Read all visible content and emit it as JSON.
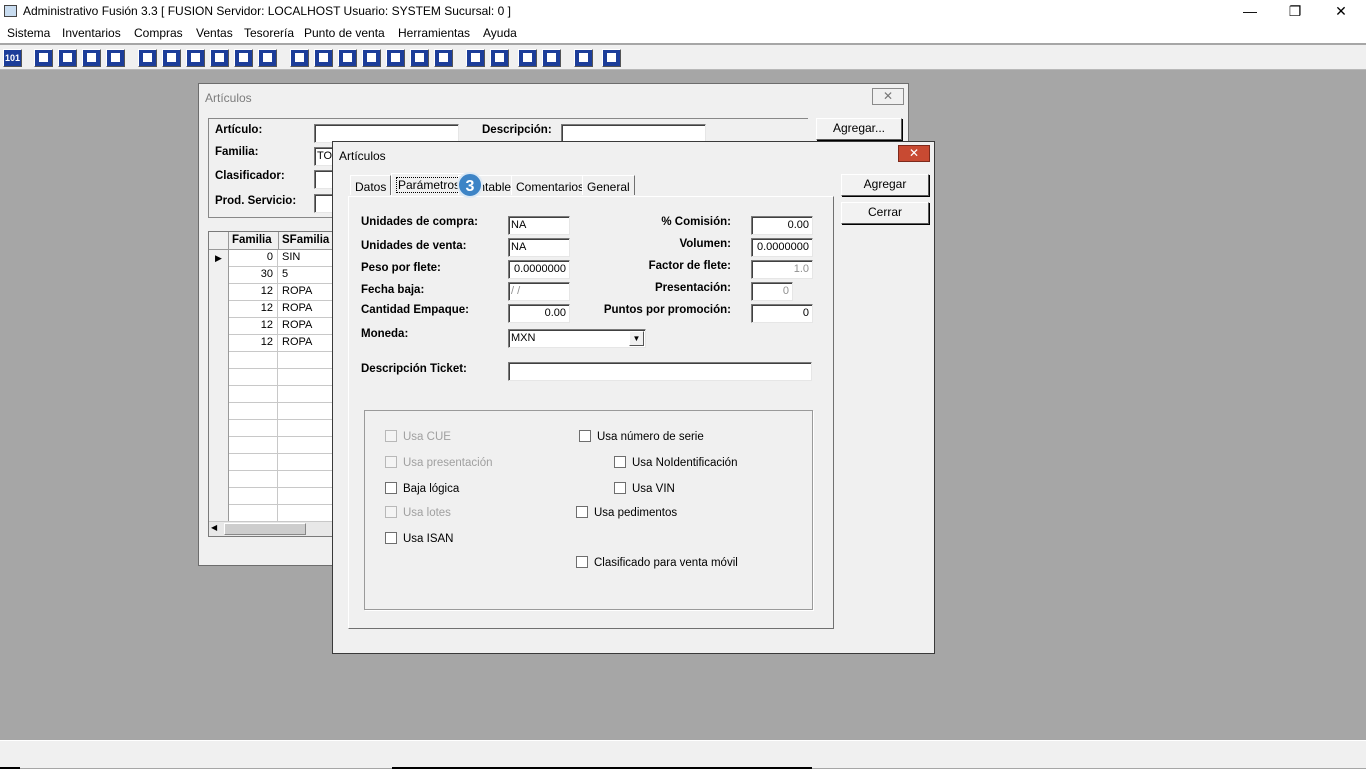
{
  "app": {
    "title": "Administrativo Fusión 3.3 [ FUSION  Servidor: LOCALHOST   Usuario: SYSTEM    Sucursal: 0 ]",
    "window_controls": {
      "minimize": "—",
      "restore": "❐",
      "close": "✕"
    }
  },
  "menu": [
    "Sistema",
    "Inventarios",
    "Compras",
    "Ventas",
    "Tesorería",
    "Punto de venta",
    "Herramientas",
    "Ayuda"
  ],
  "toolbar_first_label": "101",
  "bg_window": {
    "title": "Artículos",
    "close": "✕",
    "labels": {
      "articulo": "Artículo:",
      "descripcion": "Descripción:",
      "familia": "Familia:",
      "clasificador": "Clasificador:",
      "prod_servicio": "Prod. Servicio:"
    },
    "familia_value": "TO",
    "add_button": "Agregar...",
    "grid": {
      "headers": [
        "Familia",
        "SFamilia"
      ],
      "current_marker": "▶",
      "rows": [
        {
          "familia": "0",
          "sfamilia": "SIN"
        },
        {
          "familia": "30",
          "sfamilia": "5"
        },
        {
          "familia": "12",
          "sfamilia": "ROPA"
        },
        {
          "familia": "12",
          "sfamilia": "ROPA"
        },
        {
          "familia": "12",
          "sfamilia": "ROPA"
        },
        {
          "familia": "12",
          "sfamilia": "ROPA"
        }
      ],
      "scroll_arrow": "◀"
    }
  },
  "dialog": {
    "title": "Artículos",
    "close": "✕",
    "tabs": [
      "Datos",
      "Parámetros",
      "Contable",
      "Comentarios",
      "General"
    ],
    "active_tab": "Parámetros",
    "step_badge": "3",
    "buttons": {
      "agregar": "Agregar",
      "cerrar": "Cerrar"
    },
    "left_fields": [
      {
        "label": "Unidades de compra:",
        "value": "NA"
      },
      {
        "label": "Unidades de venta:",
        "value": "NA"
      },
      {
        "label": "Peso por flete:",
        "value": "0.0000000"
      },
      {
        "label": "Fecha baja:",
        "value": " /  /"
      },
      {
        "label": "Cantidad Empaque:",
        "value": "0.00"
      }
    ],
    "right_fields": [
      {
        "label": "% Comisión:",
        "value": "0.00"
      },
      {
        "label": "Volumen:",
        "value": "0.0000000"
      },
      {
        "label": "Factor de flete:",
        "value": "1.0"
      },
      {
        "label": "Presentación:",
        "value": "0"
      },
      {
        "label": "Puntos por promoción:",
        "value": "0"
      }
    ],
    "moneda": {
      "label": "Moneda:",
      "value": "MXN",
      "arrow": "▼"
    },
    "ticket": {
      "label": "Descripción Ticket:",
      "value": ""
    },
    "checkboxes": {
      "usa_cue": "Usa CUE",
      "usa_presentacion": "Usa presentación",
      "baja_logica": "Baja lógica",
      "usa_lotes": "Usa lotes",
      "usa_isan": "Usa ISAN",
      "usa_numero_serie": "Usa número de serie",
      "usa_noidentificacion": "Usa NoIdentificación",
      "usa_vin": "Usa VIN",
      "usa_pedimentos": "Usa pedimentos",
      "clasificado_venta_movil": "Clasificado para venta móvil"
    }
  }
}
